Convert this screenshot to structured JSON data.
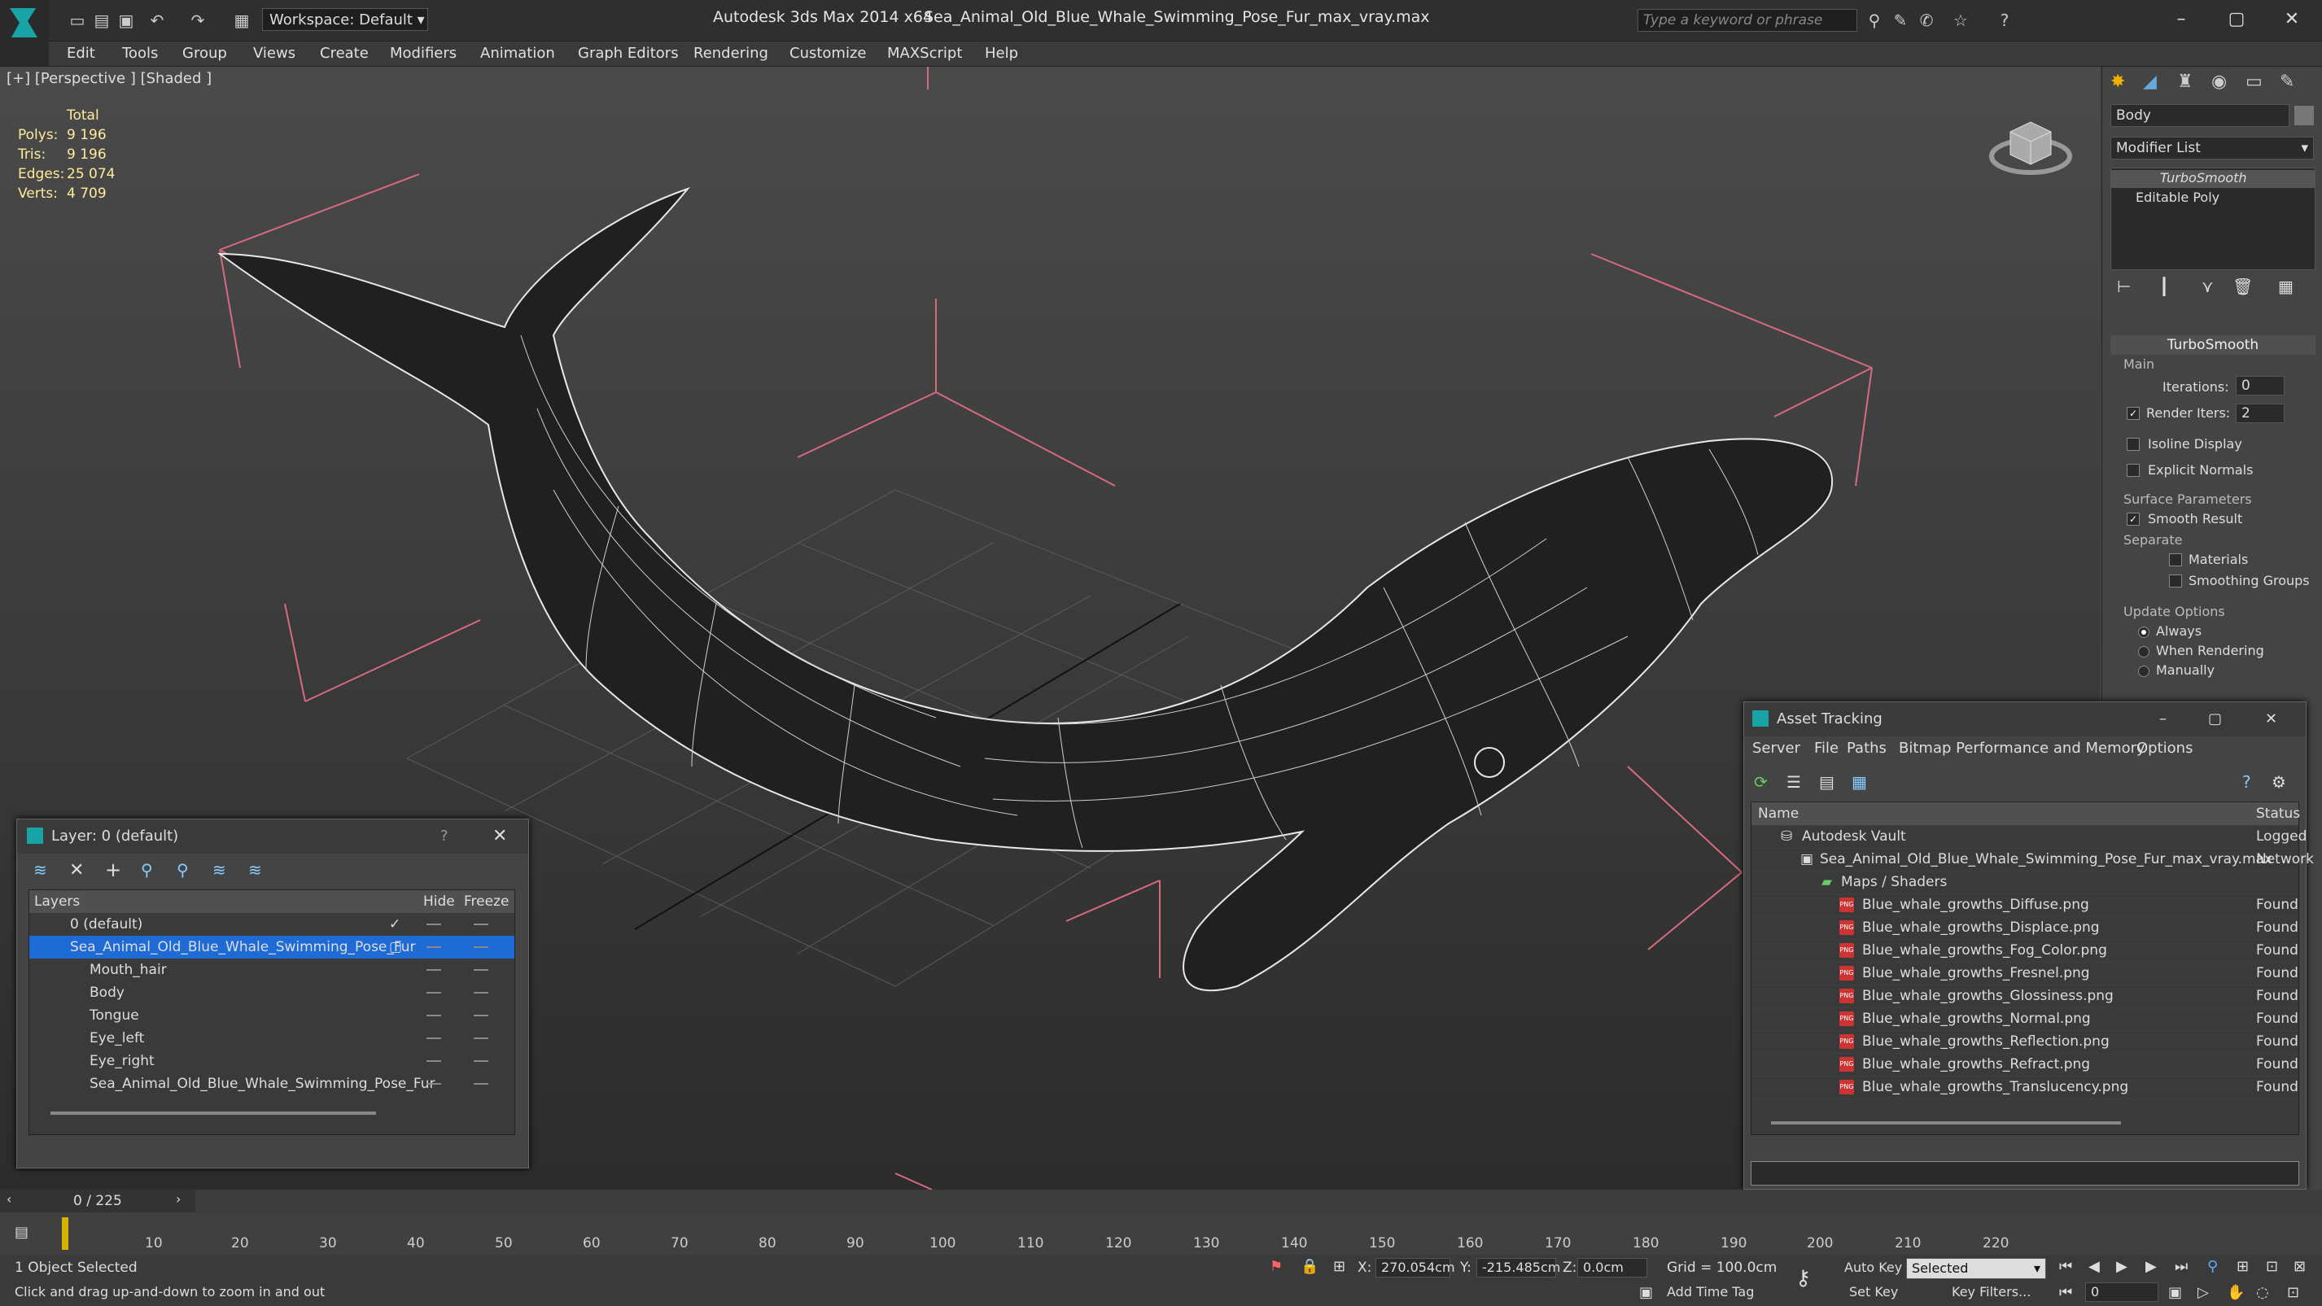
{
  "app_title": "Autodesk 3ds Max  2014 x64",
  "file_name": "Sea_Animal_Old_Blue_Whale_Swimming_Pose_Fur_max_vray.max",
  "workspace": "Workspace: Default",
  "search_placeholder": "Type a keyword or phrase",
  "menu": [
    "Edit",
    "Tools",
    "Group",
    "Views",
    "Create",
    "Modifiers",
    "Animation",
    "Graph Editors",
    "Rendering",
    "Customize",
    "MAXScript",
    "Help"
  ],
  "viewport": {
    "label": "[+] [Perspective ] [Shaded ]",
    "stats_header": "Total",
    "stats": [
      {
        "k": "Polys:",
        "v": "9 196"
      },
      {
        "k": "Tris:",
        "v": "9 196"
      },
      {
        "k": "Edges:",
        "v": "25 074"
      },
      {
        "k": "Verts:",
        "v": "4 709"
      }
    ]
  },
  "command_panel": {
    "object_name": "Body",
    "modifier_list": "Modifier List",
    "stack": [
      "TurboSmooth",
      "Editable Poly"
    ],
    "rollout_title": "TurboSmooth",
    "main_label": "Main",
    "iterations_label": "Iterations:",
    "iterations_value": "0",
    "render_iters_label": "Render Iters:",
    "render_iters_value": "2",
    "isoline": "Isoline Display",
    "explicit_normals": "Explicit Normals",
    "surface_params": "Surface Parameters",
    "smooth_result": "Smooth Result",
    "separate": "Separate",
    "materials": "Materials",
    "smoothing_groups": "Smoothing Groups",
    "update_options": "Update Options",
    "always": "Always",
    "when_rendering": "When Rendering",
    "manually": "Manually"
  },
  "layer_window": {
    "title": "Layer: 0 (default)",
    "help": "?",
    "col_layers": "Layers",
    "col_hide": "Hide",
    "col_freeze": "Freeze",
    "rows": [
      {
        "name": "0 (default)"
      },
      {
        "name": "Sea_Animal_Old_Blue_Whale_Swimming_Pose_Fur"
      },
      {
        "name": "Mouth_hair"
      },
      {
        "name": "Body"
      },
      {
        "name": "Tongue"
      },
      {
        "name": "Eye_left"
      },
      {
        "name": "Eye_right"
      },
      {
        "name": "Sea_Animal_Old_Blue_Whale_Swimming_Pose_Fur"
      }
    ]
  },
  "asset_window": {
    "title": "Asset Tracking",
    "menu": [
      "Server",
      "File",
      "Paths",
      "Bitmap Performance and Memory",
      "Options"
    ],
    "col_name": "Name",
    "col_status": "Status",
    "rows": [
      {
        "name": "Autodesk Vault",
        "status": "Logged"
      },
      {
        "name": "Sea_Animal_Old_Blue_Whale_Swimming_Pose_Fur_max_vray.max",
        "status": "Network"
      },
      {
        "name": "Maps / Shaders",
        "status": ""
      },
      {
        "name": "Blue_whale_growths_Diffuse.png",
        "status": "Found"
      },
      {
        "name": "Blue_whale_growths_Displace.png",
        "status": "Found"
      },
      {
        "name": "Blue_whale_growths_Fog_Color.png",
        "status": "Found"
      },
      {
        "name": "Blue_whale_growths_Fresnel.png",
        "status": "Found"
      },
      {
        "name": "Blue_whale_growths_Glossiness.png",
        "status": "Found"
      },
      {
        "name": "Blue_whale_growths_Normal.png",
        "status": "Found"
      },
      {
        "name": "Blue_whale_growths_Reflection.png",
        "status": "Found"
      },
      {
        "name": "Blue_whale_growths_Refract.png",
        "status": "Found"
      },
      {
        "name": "Blue_whale_growths_Translucency.png",
        "status": "Found"
      }
    ]
  },
  "timeline": {
    "frame": "0 / 225",
    "ticks": [
      "10",
      "20",
      "30",
      "40",
      "50",
      "60",
      "70",
      "80",
      "90",
      "100",
      "110",
      "120",
      "130",
      "140",
      "150",
      "160",
      "170",
      "180",
      "190",
      "200",
      "210",
      "220"
    ]
  },
  "status": {
    "selected": "1 Object Selected",
    "hint": "Click and drag up-and-down to zoom in and out",
    "x_label": "X:",
    "x": "270.054cm",
    "y_label": "Y:",
    "y": "-215.485cm",
    "z_label": "Z:",
    "z": "0.0cm",
    "grid": "Grid = 100.0cm",
    "auto_key": "Auto Key",
    "set_key": "Set Key",
    "selected_dropdown": "Selected",
    "key_filters": "Key Filters...",
    "add_time_tag": "Add Time Tag",
    "frame_field": "0"
  }
}
